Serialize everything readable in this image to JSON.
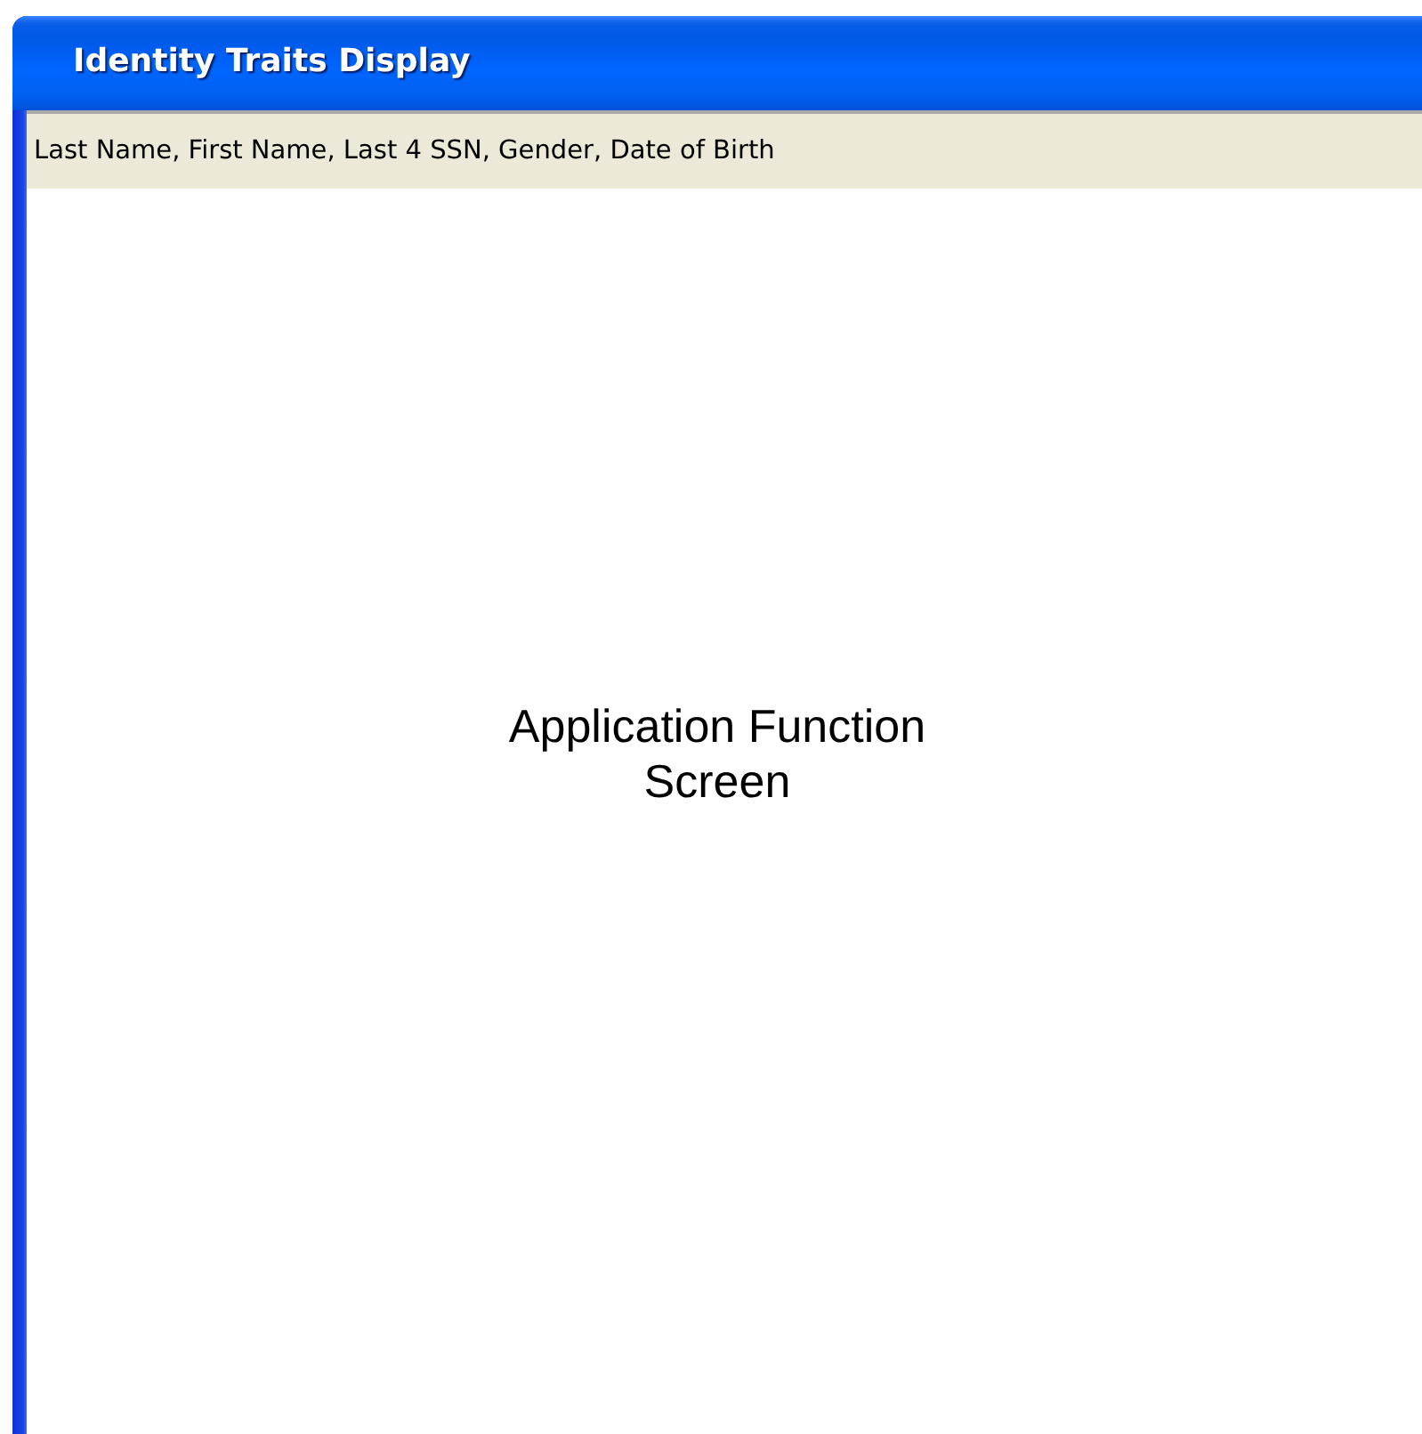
{
  "window": {
    "title": "Identity Traits Display"
  },
  "traits_bar": {
    "text": "Last Name, First Name, Last 4 SSN, Gender, Date of Birth"
  },
  "content": {
    "text": "Application Function\nScreen"
  }
}
